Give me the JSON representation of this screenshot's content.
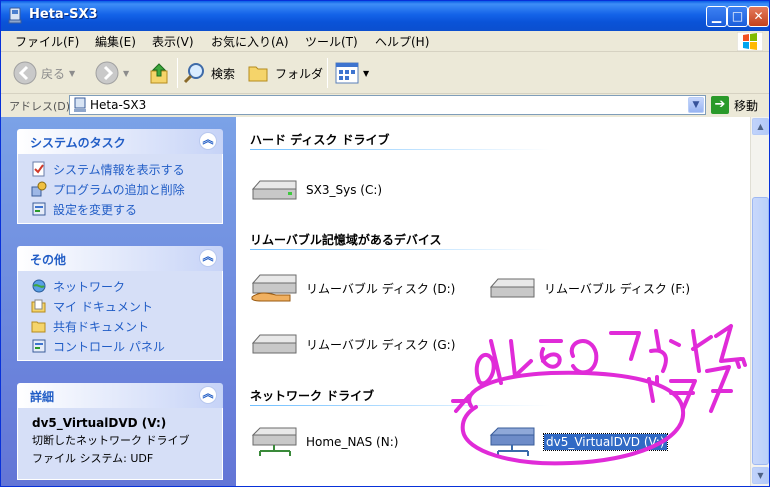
{
  "window": {
    "title": "Heta-SX3"
  },
  "menu": [
    "ファイル(F)",
    "編集(E)",
    "表示(V)",
    "お気に入り(A)",
    "ツール(T)",
    "ヘルプ(H)"
  ],
  "toolbar": {
    "back": "戻る",
    "search": "検索",
    "folders": "フォルダ"
  },
  "address": {
    "label": "アドレス(D)",
    "value": "Heta-SX3",
    "go": "移動"
  },
  "tasks": {
    "system": {
      "title": "システムのタスク",
      "links": [
        "システム情報を表示する",
        "プログラムの追加と削除",
        "設定を変更する"
      ]
    },
    "other": {
      "title": "その他",
      "links": [
        "ネットワーク",
        "マイ ドキュメント",
        "共有ドキュメント",
        "コントロール パネル"
      ]
    },
    "details": {
      "title": "詳細",
      "name": "dv5_VirtualDVD (V:)",
      "type": "切断したネットワーク ドライブ",
      "fs": "ファイル システム: UDF"
    }
  },
  "groups": {
    "hdd": {
      "title": "ハード ディスク ドライブ",
      "items": [
        "SX3_Sys (C:)"
      ]
    },
    "removable": {
      "title": "リムーバブル記憶域があるデバイス",
      "items": [
        "リムーバブル ディスク (D:)",
        "リムーバブル ディスク (F:)",
        "リムーバブル ディスク (G:)"
      ]
    },
    "network": {
      "title": "ネットワーク ドライブ",
      "items": [
        "Home_NAS (N:)",
        "dv5_VirtualDVD (V:)"
      ]
    }
  },
  "annotation": {
    "color": "#E02BD8",
    "handwritten_note": "dv5のマウントドライブ"
  },
  "colors": {
    "titlebar": "#0A53D8",
    "task_link": "#215DC6",
    "selection": "#316AC5"
  }
}
